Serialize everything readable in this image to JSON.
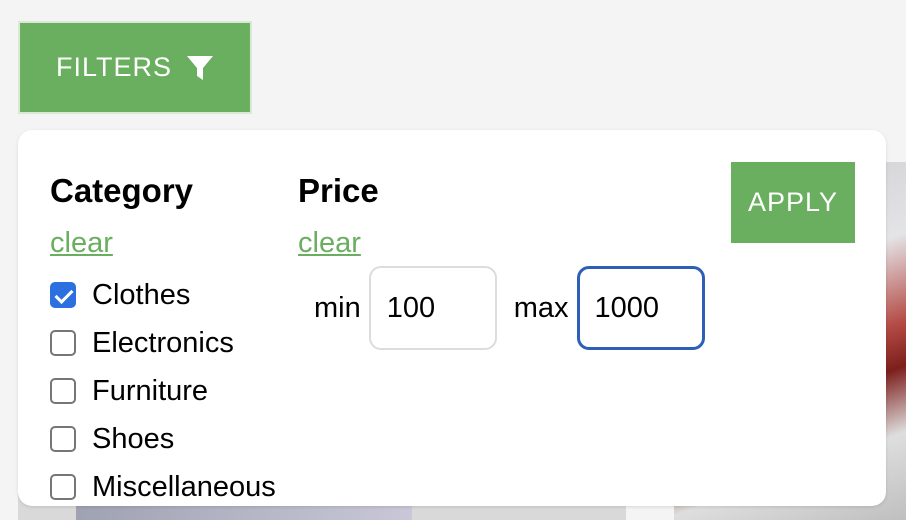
{
  "toolbar": {
    "filters_label": "FILTERS",
    "filters_icon": "funnel-icon"
  },
  "panel": {
    "apply_label": "APPLY",
    "category": {
      "title": "Category",
      "clear_label": "clear",
      "items": [
        {
          "label": "Clothes",
          "checked": true
        },
        {
          "label": "Electronics",
          "checked": false
        },
        {
          "label": "Furniture",
          "checked": false
        },
        {
          "label": "Shoes",
          "checked": false
        },
        {
          "label": "Miscellaneous",
          "checked": false
        }
      ]
    },
    "price": {
      "title": "Price",
      "clear_label": "clear",
      "min_label": "min",
      "min_value": "100",
      "max_label": "max",
      "max_value": "1000"
    }
  },
  "colors": {
    "accent_green": "#6aae5f",
    "checkbox_blue": "#2b6fe0",
    "focus_blue": "#2d5fb8"
  }
}
